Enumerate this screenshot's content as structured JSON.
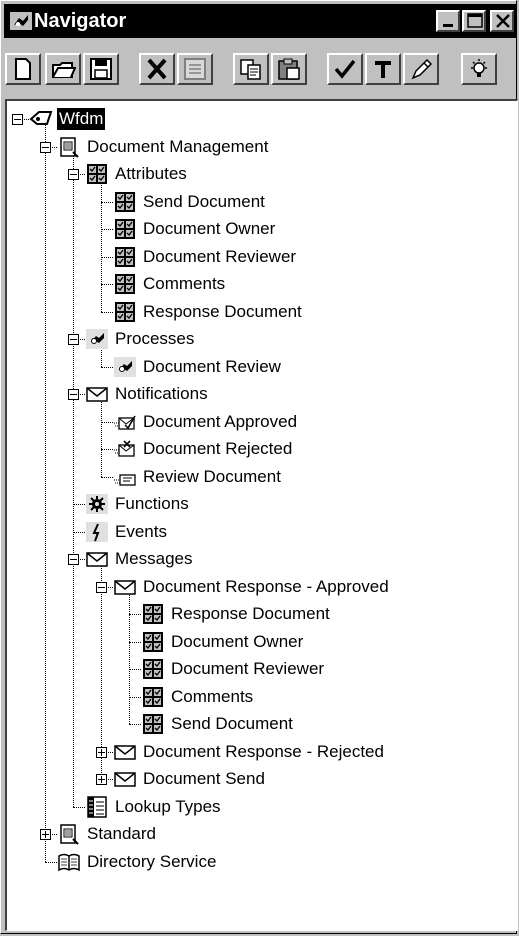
{
  "window": {
    "title": "Navigator"
  },
  "titlebar_buttons": [
    {
      "name": "minimize-icon"
    },
    {
      "name": "maximize-icon"
    },
    {
      "name": "close-icon"
    }
  ],
  "toolbar": [
    {
      "name": "new-icon"
    },
    {
      "name": "open-icon"
    },
    {
      "name": "save-icon"
    },
    {
      "name": "delete-icon"
    },
    {
      "name": "properties-icon"
    },
    {
      "name": "copy-icon"
    },
    {
      "name": "paste-icon"
    },
    {
      "name": "verify-icon"
    },
    {
      "name": "pin-icon"
    },
    {
      "name": "edit-icon"
    },
    {
      "name": "hint-icon"
    }
  ],
  "tree": [
    {
      "label": "Wfdm",
      "icon": "server-icon",
      "level": 0,
      "expander": "minus",
      "selected": true
    },
    {
      "label": "Document Management",
      "icon": "item-type-icon",
      "level": 1,
      "expander": "minus"
    },
    {
      "label": "Attributes",
      "icon": "attribute-icon",
      "level": 2,
      "expander": "minus"
    },
    {
      "label": "Send Document",
      "icon": "attribute-icon",
      "level": 3
    },
    {
      "label": "Document Owner",
      "icon": "attribute-icon",
      "level": 3
    },
    {
      "label": "Document Reviewer",
      "icon": "attribute-icon",
      "level": 3
    },
    {
      "label": "Comments",
      "icon": "attribute-icon",
      "level": 3
    },
    {
      "label": "Response Document",
      "icon": "attribute-icon",
      "level": 3
    },
    {
      "label": "Processes",
      "icon": "process-icon",
      "level": 2,
      "expander": "minus"
    },
    {
      "label": "Document Review",
      "icon": "process-icon",
      "level": 3
    },
    {
      "label": "Notifications",
      "icon": "envelope-icon",
      "level": 2,
      "expander": "minus"
    },
    {
      "label": "Document Approved",
      "icon": "notification-approved-icon",
      "level": 3
    },
    {
      "label": "Document Rejected",
      "icon": "notification-rejected-icon",
      "level": 3
    },
    {
      "label": "Review Document",
      "icon": "notification-review-icon",
      "level": 3
    },
    {
      "label": "Functions",
      "icon": "function-icon",
      "level": 2
    },
    {
      "label": "Events",
      "icon": "event-icon",
      "level": 2
    },
    {
      "label": "Messages",
      "icon": "message-icon",
      "level": 2,
      "expander": "minus"
    },
    {
      "label": "Document Response -  Approved",
      "icon": "message-icon",
      "level": 3,
      "expander": "minus"
    },
    {
      "label": "Response Document",
      "icon": "attribute-icon",
      "level": 4
    },
    {
      "label": "Document Owner",
      "icon": "attribute-icon",
      "level": 4
    },
    {
      "label": "Document Reviewer",
      "icon": "attribute-icon",
      "level": 4
    },
    {
      "label": "Comments",
      "icon": "attribute-icon",
      "level": 4
    },
    {
      "label": "Send Document",
      "icon": "attribute-icon",
      "level": 4
    },
    {
      "label": "Document Response -  Rejected",
      "icon": "message-icon",
      "level": 3,
      "expander": "plus"
    },
    {
      "label": "Document Send",
      "icon": "message-icon",
      "level": 3,
      "expander": "plus"
    },
    {
      "label": "Lookup Types",
      "icon": "lookup-icon",
      "level": 2
    },
    {
      "label": "Standard",
      "icon": "item-type-icon",
      "level": 1,
      "expander": "plus"
    },
    {
      "label": "Directory Service",
      "icon": "book-icon",
      "level": 1
    }
  ]
}
